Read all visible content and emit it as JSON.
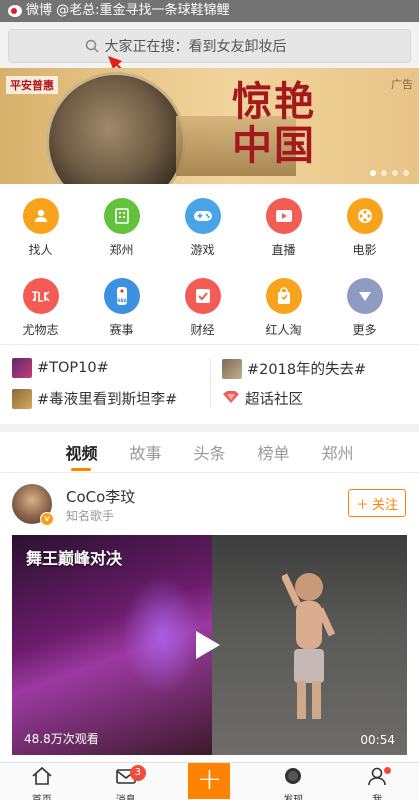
{
  "watermark": {
    "text": "微博 @老总:重金寻找一条球鞋锦鲤"
  },
  "search": {
    "value": "大家正在搜：看到女友卸妆后"
  },
  "banner": {
    "brand": "平安普惠",
    "headline": "惊艳中国",
    "ad_label": "广告",
    "slides": 4,
    "active_slide": 1
  },
  "grid": [
    {
      "label": "找人",
      "icon": "person-icon",
      "color": "#f7a31b"
    },
    {
      "label": "郑州",
      "icon": "building-icon",
      "color": "#64c13c"
    },
    {
      "label": "游戏",
      "icon": "gamepad-icon",
      "color": "#4aa3e6"
    },
    {
      "label": "直播",
      "icon": "video-play-icon",
      "color": "#f25c54"
    },
    {
      "label": "电影",
      "icon": "film-reel-icon",
      "color": "#f7a31b"
    },
    {
      "label": "尤物志",
      "icon": "youwu-icon",
      "color": "#f25c54"
    },
    {
      "label": "赛事",
      "icon": "nba-icon",
      "color": "#3d8fe0"
    },
    {
      "label": "财经",
      "icon": "finance-check-icon",
      "color": "#f25c54"
    },
    {
      "label": "红人淘",
      "icon": "shopping-bag-icon",
      "color": "#f7a31b"
    },
    {
      "label": "更多",
      "icon": "chevron-down-icon",
      "color": "#8e9cc4"
    }
  ],
  "topics": [
    {
      "label": "#TOP10#"
    },
    {
      "label": "#2018年的失去#"
    },
    {
      "label": "#毒液里看到斯坦李#"
    },
    {
      "label": "超话社区"
    }
  ],
  "tabs": [
    {
      "label": "视频",
      "active": true
    },
    {
      "label": "故事",
      "active": false
    },
    {
      "label": "头条",
      "active": false
    },
    {
      "label": "榜单",
      "active": false
    },
    {
      "label": "郑州",
      "active": false
    }
  ],
  "post": {
    "username": "CoCo李玟",
    "user_tag": "知名歌手",
    "follow_label": "关注",
    "video_title": "舞王巅峰对决",
    "views": "48.8万次观看",
    "duration": "00:54"
  },
  "tabbar": {
    "items": [
      {
        "label": "首页",
        "icon": "home-icon"
      },
      {
        "label": "消息",
        "icon": "envelope-icon",
        "badge": "3"
      },
      {
        "label": "",
        "icon": "plus-icon"
      },
      {
        "label": "发现",
        "icon": "compass-icon"
      },
      {
        "label": "我",
        "icon": "profile-icon"
      }
    ]
  }
}
